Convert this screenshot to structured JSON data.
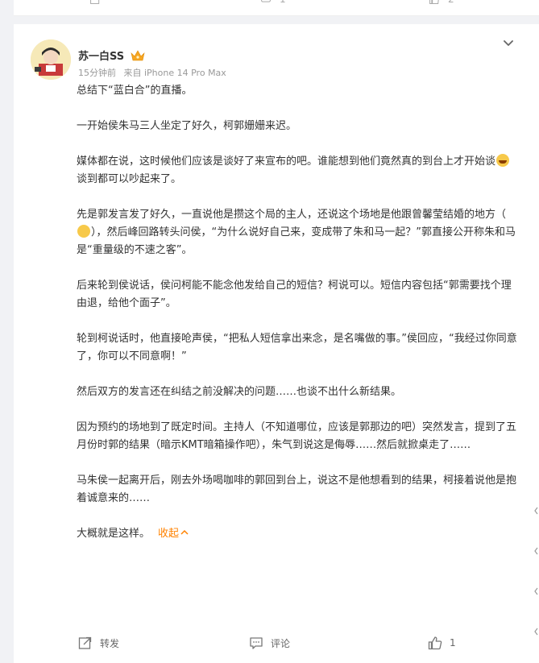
{
  "post": {
    "username": "苏一白SS",
    "time": "15分钟前",
    "source": "来自 iPhone 14 Pro Max",
    "paragraphs": {
      "p1": "总结下“蓝白合”的直播。",
      "p2": "一开始侯朱马三人坐定了好久，柯郭姗姗来迟。",
      "p3a": "媒体都在说，这时候他们应该是谈好了来宣布的吧。谁能想到他们竟然真的到台上才开始谈",
      "p3b": "谈到都可以吵起来了。",
      "p4a": "先是郭发言发了好久，一直说他是攒这个局的主人，还说这个场地是他跟曾馨莹结婚的地方（",
      "p4b": "），然后峰回路转头问侯，“为什么说好自己来，变成带了朱和马一起？”郭直接公开称朱和马是“重量级的不速之客”。",
      "p5": "后来轮到侯说话，侯问柯能不能念他发给自己的短信？柯说可以。短信内容包括“郭需要找个理由退，给他个面子”。",
      "p6": "轮到柯说话时，他直接呛声侯，“把私人短信拿出来念，是名嘴做的事。”侯回应，“我经过你同意了，你可以不同意啊！”",
      "p7": "然后双方的发言还在纠结之前没解决的问题……也谈不出什么新结果。",
      "p8": "因为预约的场地到了既定时间。主持人（不知道哪位，应该是郭那边的吧）突然发言，提到了五月份时郭的结果（暗示KMT暗箱操作吧），朱气到说这是侮辱……然后就掀桌走了……",
      "p9": "马朱侯一起离开后，刚去外场喝咖啡的郭回到台上，说这不是他想看到的结果，柯接着说他是抱着诚意来的……",
      "p10": "大概就是这样。"
    },
    "collapse_label": "收起",
    "actions": {
      "repost_label": "转发",
      "comment_label": "评论",
      "like_count": "1"
    }
  },
  "prev_post": {
    "like_count": "2",
    "comment_count": "1"
  },
  "colors": {
    "accent": "#ff8200",
    "meta": "#999999",
    "background": "#f1f2f5"
  },
  "icons": [
    "crown-icon",
    "chevron-down-icon",
    "laugh-emoji-icon",
    "thinking-emoji-icon",
    "repost-icon",
    "comment-icon",
    "like-icon"
  ]
}
